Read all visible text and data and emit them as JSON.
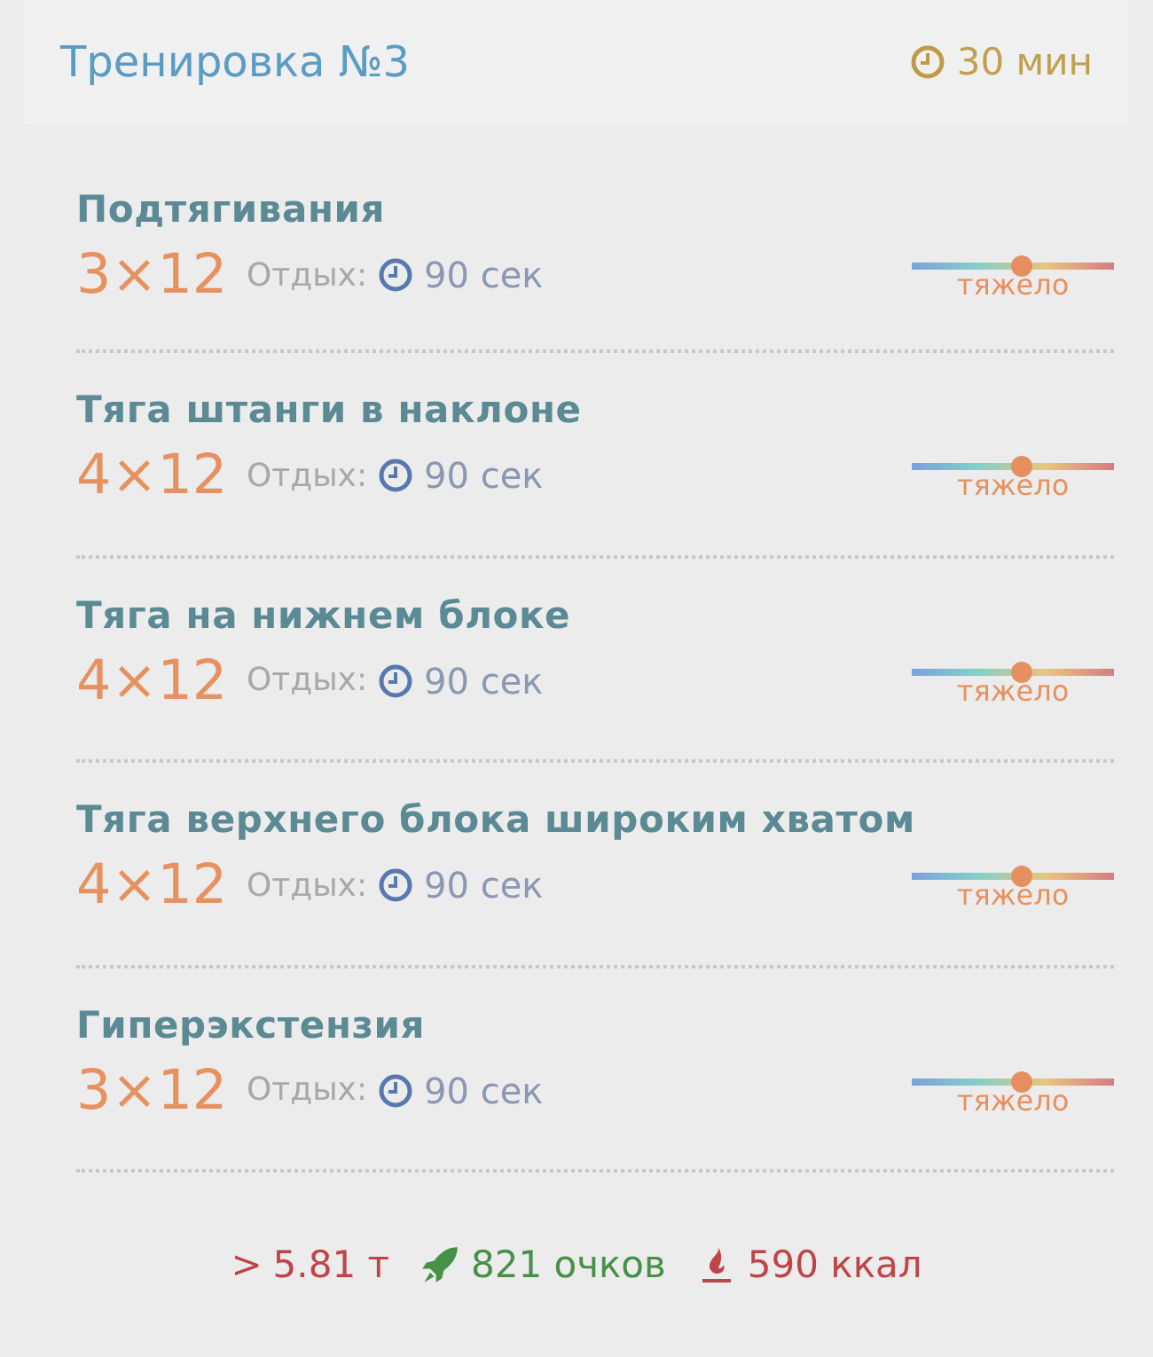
{
  "header": {
    "title": "Тренировка №3",
    "duration": "30 мин"
  },
  "exercises": [
    {
      "name": "Подтягивания",
      "sets": "3×12",
      "rest_label": "Отдых:",
      "rest": "90 сек",
      "level": 0.54,
      "difficulty": "тяжело"
    },
    {
      "name": "Тяга штанги в наклоне",
      "sets": "4×12",
      "rest_label": "Отдых:",
      "rest": "90 сек",
      "level": 0.54,
      "difficulty": "тяжело"
    },
    {
      "name": "Тяга на нижнем блоке",
      "sets": "4×12",
      "rest_label": "Отдых:",
      "rest": "90 сек",
      "level": 0.54,
      "difficulty": "тяжело"
    },
    {
      "name": "Тяга верхнего блока широким хватом",
      "sets": "4×12",
      "rest_label": "Отдых:",
      "rest": "90 сек",
      "level": 0.54,
      "difficulty": "тяжело"
    },
    {
      "name": "Гиперэкстензия",
      "sets": "3×12",
      "rest_label": "Отдых:",
      "rest": "90 сек",
      "level": 0.54,
      "difficulty": "тяжело"
    }
  ],
  "summary": {
    "tonnage_mark": ">",
    "tonnage": "5.81 т",
    "points": "821 очков",
    "calories": "590 ккал"
  }
}
